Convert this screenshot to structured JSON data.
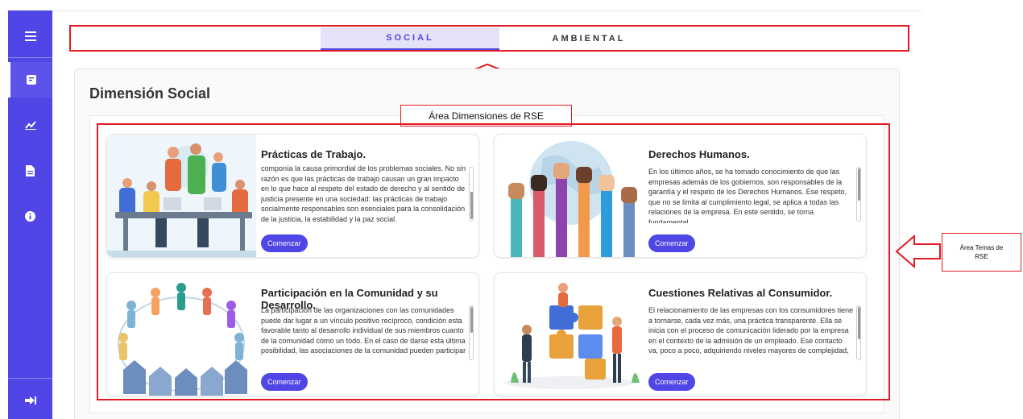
{
  "tabs": {
    "social": "SOCIAL",
    "ambiental": "AMBIENTAL",
    "active": "social"
  },
  "section": {
    "title": "Dimensión Social"
  },
  "callouts": {
    "dimensiones": "Área Dimensiones de RSE",
    "temas": "Área Temas de RSE"
  },
  "sidebar": {
    "icons": [
      "menu-icon",
      "clipboard-icon",
      "chart-icon",
      "document-icon",
      "info-icon",
      "logout-icon"
    ]
  },
  "cards": [
    {
      "title": "Prácticas de Trabajo.",
      "text": "componía la causa primordial de los problemas sociales. No sin razón es que las prácticas de trabajo causan un gran impacto en lo que hace al respeto del estado de derecho y al sentido de justicia presente en una sociedad: las prácticas de trabajo socialmente responsables son esenciales para la consolidación de la justicia, la estabilidad y la paz social.",
      "button": "Comenzar"
    },
    {
      "title": "Derechos Humanos.",
      "text": "En los últimos años, se ha tomado conocimiento de que las empresas además de los gobiernos, son responsables de la garantía y el respeto de los Derechos Humanos. Ese respeto, que no se limita al cumplimiento legal, se aplica a todas las relaciones de la empresa. En este sentido, se torna fundamental",
      "button": "Comenzar"
    },
    {
      "title": "Participación en la Comunidad y su Desarrollo.",
      "text": "La participación de las organizaciones con las comunidades puede dar lugar a un vínculo positivo recíproco, condición esta favorable tanto al desarrollo individual de sus miembros cuanto de la comunidad como un todo. En el caso de darse esta última posibilidad, las asociaciones de la comunidad pueden participar",
      "button": "Comenzar"
    },
    {
      "title": "Cuestiones Relativas al Consumidor.",
      "text": "El relacionamiento de las empresas con los consumidores tiene a tornarse, cada vez más, una práctica transparente. Ella se inicia con el proceso de comunicación liderado por la empresa en el contexto de la admisión de un empleado. Ese contacto va, poco a poco, adquiriendo niveles mayores de complejidad,",
      "button": "Comenzar"
    }
  ],
  "colors": {
    "primary": "#4f46e5",
    "annotation": "#e31b23",
    "tab_active_bg": "#e4e2f7"
  }
}
